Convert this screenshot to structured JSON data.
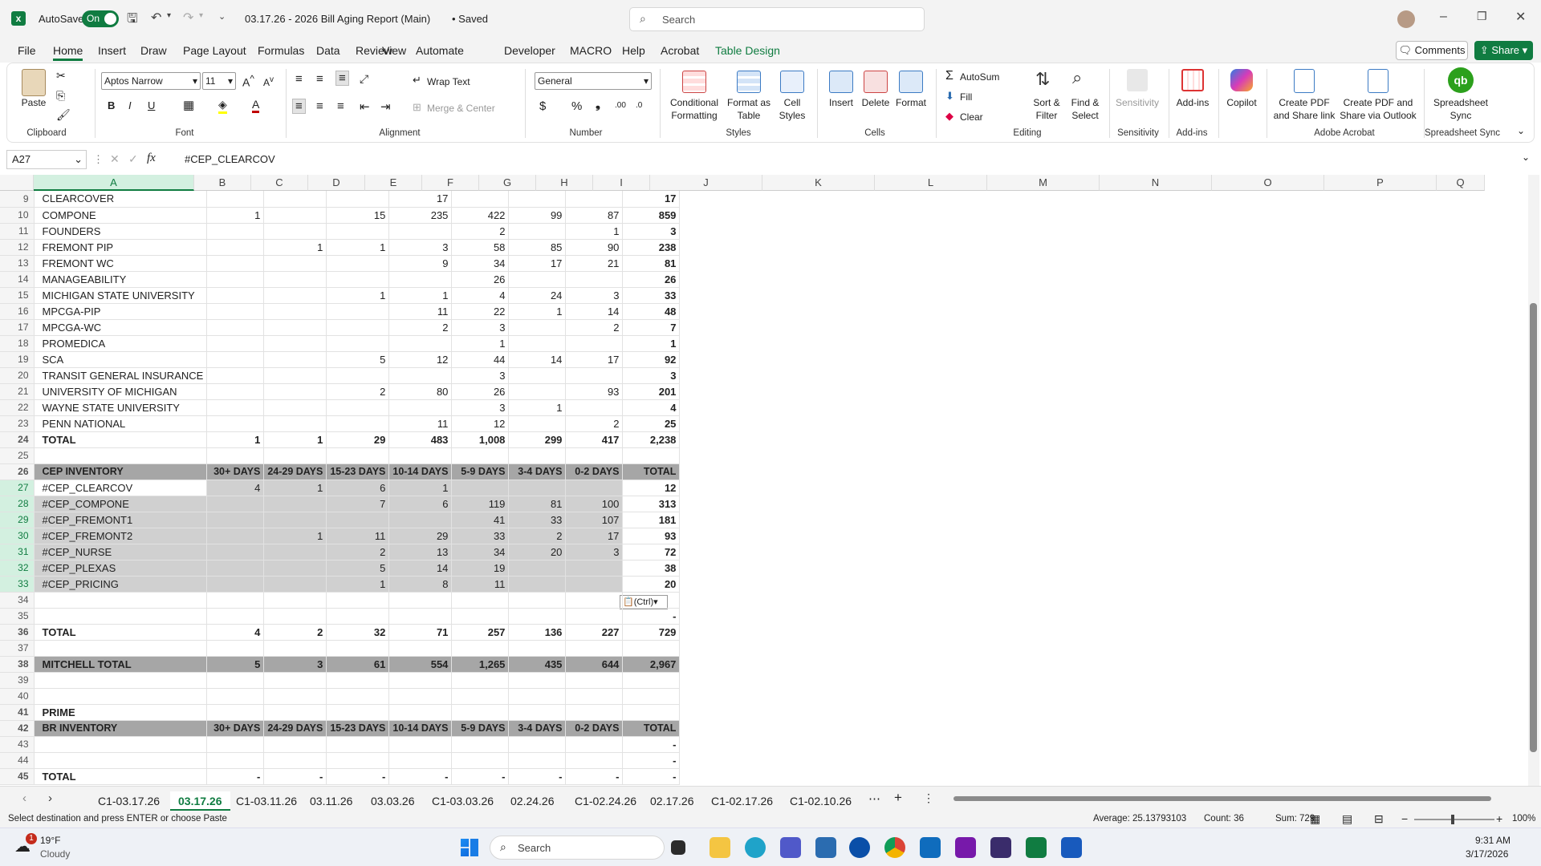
{
  "titlebar": {
    "autosave_label": "AutoSave",
    "autosave_state": "On",
    "doc_title": "03.17.26 - 2026 Bill Aging Report (Main)",
    "saved_state": "• Saved",
    "search_placeholder": "Search"
  },
  "menu": [
    "File",
    "Home",
    "Insert",
    "Draw",
    "Page Layout",
    "Formulas",
    "Data",
    "Review",
    "View",
    "Automate",
    "Developer",
    "MACRO",
    "Help",
    "Acrobat",
    "Table Design"
  ],
  "menu_right": {
    "comments": "Comments",
    "share": "Share"
  },
  "ribbon": {
    "paste": "Paste",
    "font_name": "Aptos Narrow",
    "font_size": "11",
    "wrap_text": "Wrap Text",
    "merge_center": "Merge & Center",
    "number_format": "General",
    "conditional": "Conditional Formatting",
    "format_table": "Format as Table",
    "cell_styles": "Cell Styles",
    "insert": "Insert",
    "delete": "Delete",
    "format": "Format",
    "autosum": "AutoSum",
    "fill": "Fill",
    "clear": "Clear",
    "sort_filter": "Sort & Filter",
    "find_select": "Find & Select",
    "sensitivity": "Sensitivity",
    "addins": "Add-ins",
    "copilot": "Copilot",
    "create_pdf_link": "Create PDF and Share link",
    "create_pdf_outlook": "Create PDF and Share via Outlook",
    "spreadsheet_sync": "Spreadsheet Sync",
    "groups": {
      "clipboard": "Clipboard",
      "font": "Font",
      "alignment": "Alignment",
      "number": "Number",
      "styles": "Styles",
      "cells": "Cells",
      "editing": "Editing",
      "sensitivity": "Sensitivity",
      "addins": "Add-ins",
      "acrobat": "Adobe Acrobat",
      "sync": "Spreadsheet Sync"
    }
  },
  "formula_bar": {
    "name_box": "A27",
    "formula": "#CEP_CLEARCOV"
  },
  "columns": [
    "A",
    "B",
    "C",
    "D",
    "E",
    "F",
    "G",
    "H",
    "I",
    "J",
    "K",
    "L",
    "M",
    "N",
    "O",
    "P",
    "Q"
  ],
  "rows": [
    {
      "n": "9",
      "type": "data",
      "cells": [
        "CLEARCOVER",
        "",
        "",
        "",
        "17",
        "",
        "",
        "",
        "17"
      ]
    },
    {
      "n": "10",
      "type": "data",
      "cells": [
        "COMPONE",
        "1",
        "",
        "15",
        "235",
        "422",
        "99",
        "87",
        "859"
      ]
    },
    {
      "n": "11",
      "type": "data",
      "cells": [
        "FOUNDERS",
        "",
        "",
        "",
        "",
        "2",
        "",
        "1",
        "3"
      ]
    },
    {
      "n": "12",
      "type": "data",
      "cells": [
        "FREMONT PIP",
        "",
        "1",
        "1",
        "3",
        "58",
        "85",
        "90",
        "238"
      ]
    },
    {
      "n": "13",
      "type": "data",
      "cells": [
        "FREMONT WC",
        "",
        "",
        "",
        "9",
        "34",
        "17",
        "21",
        "81"
      ]
    },
    {
      "n": "14",
      "type": "data",
      "cells": [
        "MANAGEABILITY",
        "",
        "",
        "",
        "",
        "26",
        "",
        "",
        "26"
      ]
    },
    {
      "n": "15",
      "type": "data",
      "cells": [
        "MICHIGAN STATE UNIVERSITY",
        "",
        "",
        "1",
        "1",
        "4",
        "24",
        "3",
        "33"
      ]
    },
    {
      "n": "16",
      "type": "data",
      "cells": [
        "MPCGA-PIP",
        "",
        "",
        "",
        "11",
        "22",
        "1",
        "14",
        "48"
      ]
    },
    {
      "n": "17",
      "type": "data",
      "cells": [
        "MPCGA-WC",
        "",
        "",
        "",
        "2",
        "3",
        "",
        "2",
        "7"
      ]
    },
    {
      "n": "18",
      "type": "data",
      "cells": [
        "PROMEDICA",
        "",
        "",
        "",
        "",
        "1",
        "",
        "",
        "1"
      ]
    },
    {
      "n": "19",
      "type": "data",
      "cells": [
        "SCA",
        "",
        "",
        "5",
        "12",
        "44",
        "14",
        "17",
        "92"
      ]
    },
    {
      "n": "20",
      "type": "data",
      "cells": [
        "TRANSIT GENERAL INSURANCE",
        "",
        "",
        "",
        "",
        "3",
        "",
        "",
        "3"
      ]
    },
    {
      "n": "21",
      "type": "data",
      "cells": [
        "UNIVERSITY OF MICHIGAN",
        "",
        "",
        "2",
        "80",
        "26",
        "",
        "93",
        "201"
      ]
    },
    {
      "n": "22",
      "type": "data",
      "cells": [
        "WAYNE STATE UNIVERSITY",
        "",
        "",
        "",
        "",
        "3",
        "1",
        "",
        "4"
      ]
    },
    {
      "n": "23",
      "type": "data",
      "cells": [
        "PENN NATIONAL",
        "",
        "",
        "",
        "11",
        "12",
        "",
        "2",
        "25"
      ]
    },
    {
      "n": "24",
      "type": "total",
      "cells": [
        "TOTAL",
        "1",
        "1",
        "29",
        "483",
        "1,008",
        "299",
        "417",
        "2,238"
      ]
    },
    {
      "n": "25",
      "type": "blank",
      "cells": [
        "",
        "",
        "",
        "",
        "",
        "",
        "",
        "",
        ""
      ]
    },
    {
      "n": "26",
      "type": "header",
      "cells": [
        "CEP INVENTORY",
        "30+ DAYS",
        "24-29 DAYS",
        "15-23 DAYS",
        "10-14 DAYS",
        "5-9 DAYS",
        "3-4 DAYS",
        "0-2 DAYS",
        "TOTAL"
      ]
    },
    {
      "n": "27",
      "type": "sel",
      "cells": [
        "#CEP_CLEARCOV",
        "4",
        "1",
        "6",
        "1",
        "",
        "",
        "",
        "12"
      ]
    },
    {
      "n": "28",
      "type": "sel",
      "cells": [
        "#CEP_COMPONE",
        "",
        "",
        "7",
        "6",
        "119",
        "81",
        "100",
        "313"
      ]
    },
    {
      "n": "29",
      "type": "sel",
      "cells": [
        "#CEP_FREMONT1",
        "",
        "",
        "",
        "",
        "41",
        "33",
        "107",
        "181"
      ]
    },
    {
      "n": "30",
      "type": "sel",
      "cells": [
        "#CEP_FREMONT2",
        "",
        "1",
        "11",
        "29",
        "33",
        "2",
        "17",
        "93"
      ]
    },
    {
      "n": "31",
      "type": "sel",
      "cells": [
        "#CEP_NURSE",
        "",
        "",
        "2",
        "13",
        "34",
        "20",
        "3",
        "72"
      ]
    },
    {
      "n": "32",
      "type": "sel",
      "cells": [
        "#CEP_PLEXAS",
        "",
        "",
        "5",
        "14",
        "19",
        "",
        "",
        "38"
      ]
    },
    {
      "n": "33",
      "type": "sel",
      "cells": [
        "#CEP_PRICING",
        "",
        "",
        "1",
        "8",
        "11",
        "",
        "",
        "20"
      ]
    },
    {
      "n": "34",
      "type": "blank",
      "cells": [
        "",
        "",
        "",
        "",
        "",
        "",
        "",
        "",
        ""
      ]
    },
    {
      "n": "35",
      "type": "blank",
      "cells": [
        "",
        "",
        "",
        "",
        "",
        "",
        "",
        "",
        "-"
      ]
    },
    {
      "n": "36",
      "type": "total",
      "cells": [
        "TOTAL",
        "4",
        "2",
        "32",
        "71",
        "257",
        "136",
        "227",
        "729"
      ]
    },
    {
      "n": "37",
      "type": "blank",
      "cells": [
        "",
        "",
        "",
        "",
        "",
        "",
        "",
        "",
        ""
      ]
    },
    {
      "n": "38",
      "type": "mitchell",
      "cells": [
        "MITCHELL TOTAL",
        "5",
        "3",
        "61",
        "554",
        "1,265",
        "435",
        "644",
        "2,967"
      ]
    },
    {
      "n": "39",
      "type": "blank",
      "cells": [
        "",
        "",
        "",
        "",
        "",
        "",
        "",
        "",
        ""
      ]
    },
    {
      "n": "40",
      "type": "blank",
      "cells": [
        "",
        "",
        "",
        "",
        "",
        "",
        "",
        "",
        ""
      ]
    },
    {
      "n": "41",
      "type": "bold",
      "cells": [
        "PRIME",
        "",
        "",
        "",
        "",
        "",
        "",
        "",
        ""
      ]
    },
    {
      "n": "42",
      "type": "header",
      "cells": [
        "BR INVENTORY",
        "30+ DAYS",
        "24-29 DAYS",
        "15-23 DAYS",
        "10-14 DAYS",
        "5-9 DAYS",
        "3-4 DAYS",
        "0-2 DAYS",
        "TOTAL"
      ]
    },
    {
      "n": "43",
      "type": "blank",
      "cells": [
        "",
        "",
        "",
        "",
        "",
        "",
        "",
        "",
        "-"
      ]
    },
    {
      "n": "44",
      "type": "blank",
      "cells": [
        "",
        "",
        "",
        "",
        "",
        "",
        "",
        "",
        "-"
      ]
    },
    {
      "n": "45",
      "type": "total",
      "cells": [
        "TOTAL",
        "-",
        "-",
        "-",
        "-",
        "-",
        "-",
        "-",
        "-"
      ]
    }
  ],
  "paste_options": "(Ctrl)",
  "sheet_tabs": [
    "C1-03.17.26",
    "03.17.26",
    "C1-03.11.26",
    "03.11.26",
    "03.03.26",
    "C1-03.03.26",
    "02.24.26",
    "C1-02.24.26",
    "02.17.26",
    "C1-02.17.26",
    "C1-02.10.26"
  ],
  "active_tab": "03.17.26",
  "status": {
    "message": "Select destination and press ENTER or choose Paste",
    "average": "Average: 25.13793103",
    "count": "Count: 36",
    "sum": "Sum: 729",
    "zoom": "100%"
  },
  "taskbar": {
    "weather_temp": "19°F",
    "weather_desc": "Cloudy",
    "weather_badge": "1",
    "search": "Search",
    "time": "9:31 AM",
    "date": "3/17/2026"
  },
  "colors": {
    "accent": "#107c41",
    "header_gray": "#a6a6a6",
    "selection": "#d0d0d0"
  }
}
